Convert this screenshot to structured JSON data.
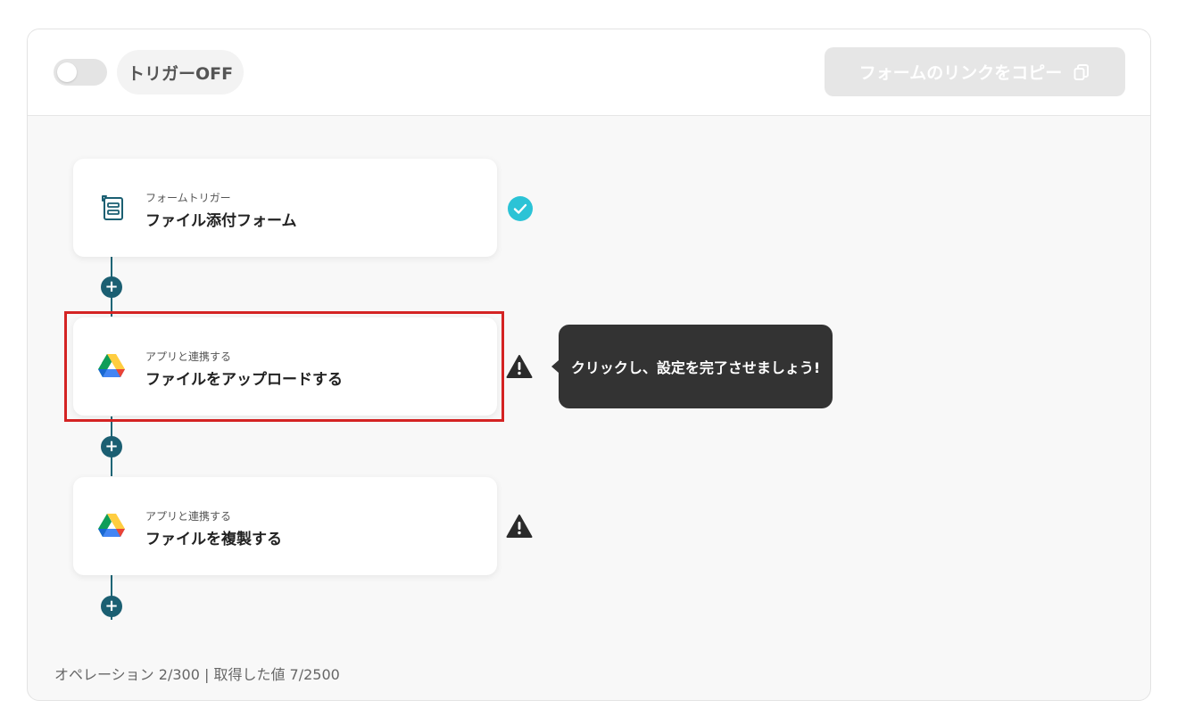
{
  "header": {
    "trigger_label": "トリガーOFF",
    "trigger_enabled": false,
    "copy_button_label": "フォームのリンクをコピー"
  },
  "flow": {
    "steps": [
      {
        "subtitle": "フォームトリガー",
        "title": "ファイル添付フォーム",
        "icon": "form-icon",
        "status": "complete"
      },
      {
        "subtitle": "アプリと連携する",
        "title": "ファイルをアップロードする",
        "icon": "google-drive-icon",
        "status": "warning"
      },
      {
        "subtitle": "アプリと連携する",
        "title": "ファイルを複製する",
        "icon": "google-drive-icon",
        "status": "warning"
      }
    ]
  },
  "tooltip": {
    "text": "クリックし、設定を完了させましょう!"
  },
  "footer": {
    "usage_text": "オペレーション 2/300 | 取得した値 7/2500"
  },
  "colors": {
    "accent": "#1b5f72",
    "check": "#2bc3d6",
    "highlight": "#d42323"
  }
}
